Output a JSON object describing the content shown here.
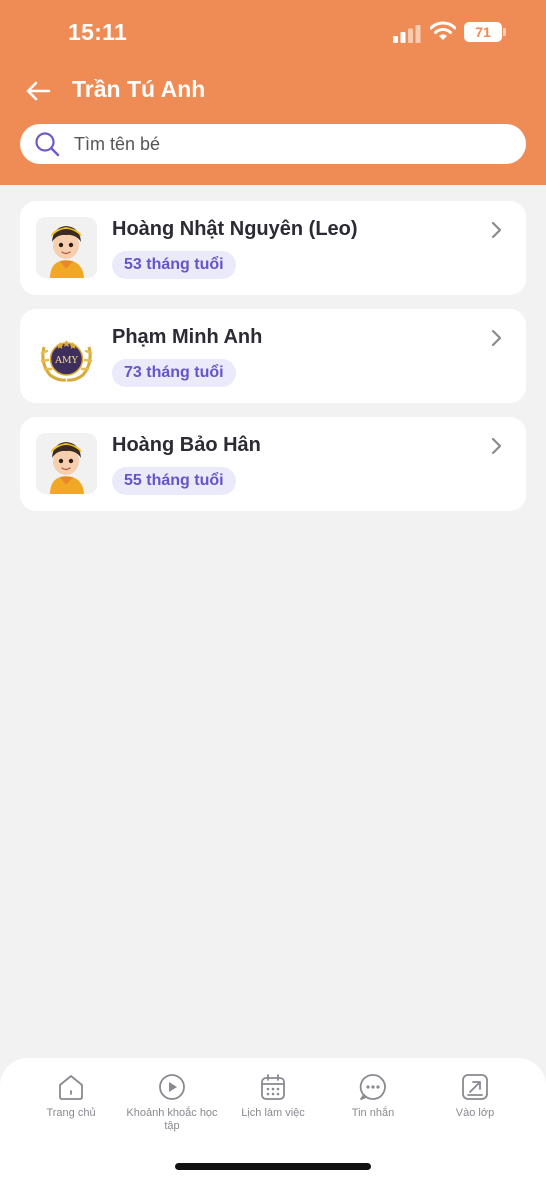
{
  "status_bar": {
    "time": "15:11",
    "battery": "71"
  },
  "header": {
    "title": "Trần Tú Anh"
  },
  "search": {
    "placeholder": "Tìm tên bé",
    "value": ""
  },
  "children": [
    {
      "name": "Hoàng Nhật Nguyên (Leo)",
      "age": "53 tháng tuổi",
      "avatar": "cartoon-boy-avatar"
    },
    {
      "name": "Phạm Minh Anh",
      "age": "73 tháng tuổi",
      "avatar": "amy-logo",
      "logo_text": "AMY"
    },
    {
      "name": "Hoàng Bảo Hân",
      "age": "55 tháng tuổi",
      "avatar": "cartoon-boy-avatar"
    }
  ],
  "nav": [
    {
      "label": "Trang chủ",
      "icon": "home-icon"
    },
    {
      "label": "Khoảnh khoắc học tập",
      "icon": "play-icon"
    },
    {
      "label": "Lịch làm việc",
      "icon": "calendar-icon"
    },
    {
      "label": "Tin nhắn",
      "icon": "chat-icon"
    },
    {
      "label": "Vào lớp",
      "icon": "enter-class-icon"
    }
  ],
  "colors": {
    "header": "#ef8c55",
    "badge_bg": "#eaeafb",
    "badge_text": "#6455c9",
    "background": "#f2f2f3"
  }
}
